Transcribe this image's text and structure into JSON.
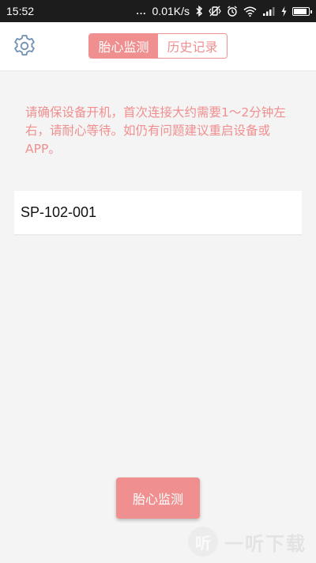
{
  "status_bar": {
    "time": "15:52",
    "signal_dots": "...",
    "network_speed": "0.01K/s",
    "battery_level": 0.8,
    "icons": [
      "bluetooth-icon",
      "vibrate-icon",
      "alarm-icon",
      "wifi-icon",
      "signal-icon",
      "charging-icon",
      "battery-icon"
    ]
  },
  "app_bar": {
    "settings_icon": "gear-icon",
    "tabs": [
      {
        "label": "胎心监测",
        "active": true
      },
      {
        "label": "历史记录",
        "active": false
      }
    ]
  },
  "notice": {
    "text": "请确保设备开机，首次连接大约需要1～2分钟左右，请耐心等待。如仍有问题建议重启设备或APP。"
  },
  "devices": [
    {
      "name": "SP-102-001"
    }
  ],
  "primary_button": {
    "label": "胎心监测"
  },
  "watermark": {
    "logo_char": "听",
    "text": "一听下载"
  },
  "colors": {
    "accent": "#ef8f8f",
    "background": "#f4f4f4",
    "status_bar": "#1c1c1c"
  }
}
